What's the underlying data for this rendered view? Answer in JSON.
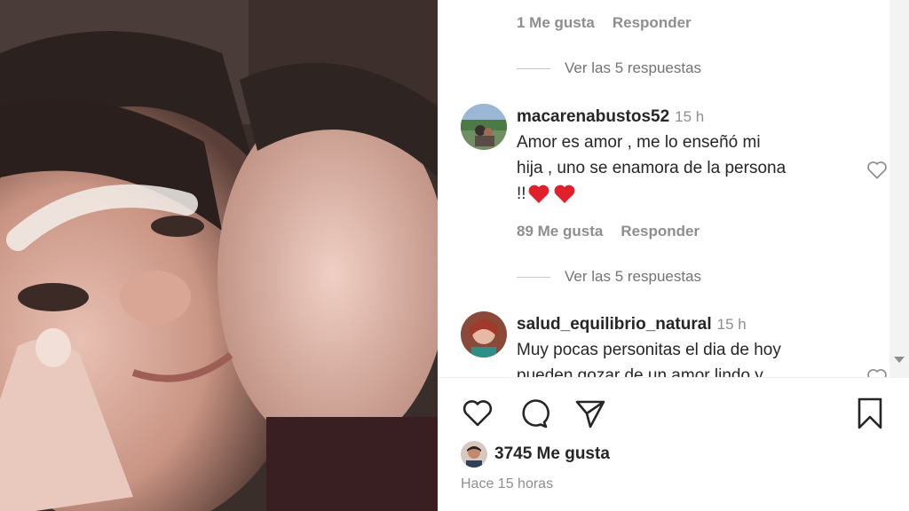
{
  "post": {
    "photo_description_icon": "photo-icon"
  },
  "comments_panel": {
    "top_meta": {
      "likes": "1 Me gusta",
      "reply": "Responder"
    },
    "view_replies_1": "Ver las 5 respuestas",
    "comment_1": {
      "username": "macarenabustos52",
      "time": "15 h",
      "text_line1": "Amor es amor , me lo enseñó mi",
      "text_line2": "hija , uno se enamora de la persona",
      "text_line3": "!!",
      "likes": "89 Me gusta",
      "reply": "Responder"
    },
    "view_replies_2": "Ver las 5 respuestas",
    "comment_2": {
      "username": "salud_equilibrio_natural",
      "time": "15 h",
      "text_line1": "Muy pocas personitas el dia de hoy",
      "text_line2": "pueden gozar de un amor lindo y"
    }
  },
  "footer": {
    "likes_count": "3745 Me gusta",
    "time_ago": "Hace 15 horas"
  },
  "colors": {
    "text": "#262626",
    "muted": "#8e8e8e",
    "heart_emoji": "#e0212d"
  }
}
